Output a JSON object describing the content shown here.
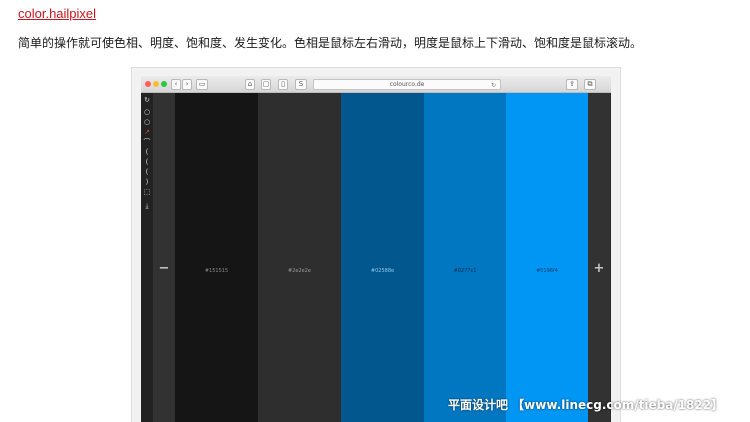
{
  "header": {
    "link_text": "color.hailpixel",
    "description": "简单的操作就可使色相、明度、饱和度、发生变化。色相是鼠标左右滑动，明度是鼠标上下滑动、饱和度是鼠标滚动。"
  },
  "browser": {
    "address": "colourco.de",
    "buttons": [
      "‹",
      "›",
      "▭",
      "⌂",
      "▢",
      "▯",
      "S",
      "⇪",
      "⧉"
    ]
  },
  "tools": {
    "icons": [
      "loop-icon",
      "circle-icon",
      "circle-icon",
      "arrow-icon",
      "arc-icon",
      "arc-icon",
      "arc-icon",
      "arc-icon",
      "arc-icon",
      "square-icon",
      "download-icon"
    ]
  },
  "palette": {
    "minus_label": "−",
    "plus_label": "+",
    "swatches": [
      {
        "hex": "#151515",
        "label": "#151515",
        "label_color": "#8a8a8a"
      },
      {
        "hex": "#2e2e2e",
        "label": "#2e2e2e",
        "label_color": "#9a9a9a"
      },
      {
        "hex": "#02588e",
        "label": "#02588e",
        "label_color": "#8ec6ea"
      },
      {
        "hex": "#0277c1",
        "label": "#0277c1",
        "label_color": "#0a2e4e"
      },
      {
        "hex": "#0196f4",
        "label": "#0196f4",
        "label_color": "#0a3e6a"
      }
    ]
  },
  "watermark": "平面设计吧 【www.linecg.com/tieba/1822】"
}
